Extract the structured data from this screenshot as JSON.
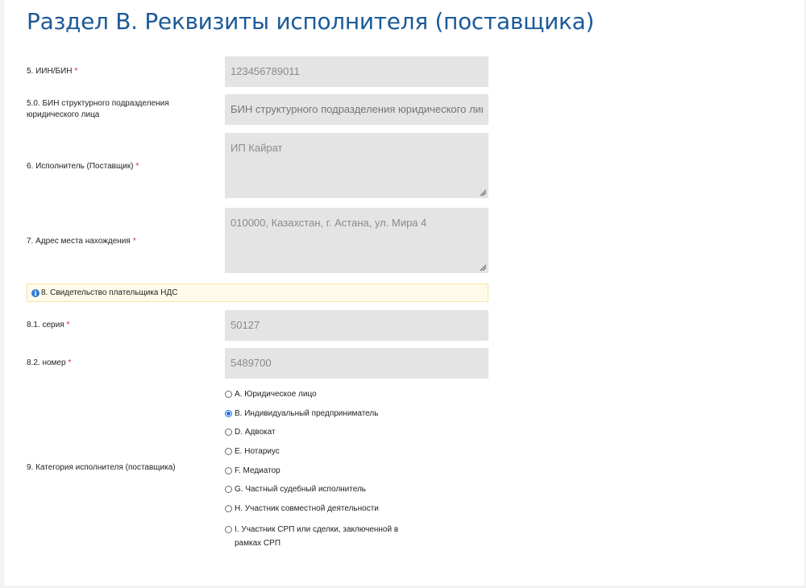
{
  "section": {
    "title": "Раздел B. Реквизиты исполнителя (поставщика)"
  },
  "fields": {
    "iin_bin": {
      "label": "5. ИИН/БИН",
      "value": "123456789011",
      "required": "*"
    },
    "branch_bin": {
      "label": "5.0. БИН структурного подразделения юридического лица",
      "placeholder": "БИН структурного подразделения юридического лица"
    },
    "supplier": {
      "label": "6. Исполнитель (Поставщик)",
      "value": "ИП Кайрат",
      "required": "*"
    },
    "address": {
      "label": "7. Адрес места нахождения",
      "value": "010000, Казахстан, г. Астана, ул. Мира 4",
      "required": "*"
    },
    "vat_notice": {
      "icon": "info-icon",
      "label": "8. Свидетельство плательщика НДС"
    },
    "series": {
      "label": "8.1. серия",
      "value": "50127",
      "required": "*"
    },
    "number": {
      "label": "8.2. номер",
      "value": "5489700",
      "required": "*"
    },
    "category": {
      "label": "9. Категория исполнителя (поставщика)",
      "selected": "B",
      "options": [
        {
          "code": "A",
          "label": "A. Юридическое лицо"
        },
        {
          "code": "B",
          "label": "B. Индивидуальный предприниматель"
        },
        {
          "code": "D",
          "label": "D. Адвокат"
        },
        {
          "code": "E",
          "label": "E. Нотариус"
        },
        {
          "code": "F",
          "label": "F. Медиатор"
        },
        {
          "code": "G",
          "label": "G. Частный судебный исполнитель"
        },
        {
          "code": "H",
          "label": "H. Участник совместной деятельности"
        },
        {
          "code": "I",
          "label": "I. Участник СРП или сделки, заключенной в рамках СРП"
        }
      ]
    }
  },
  "colors": {
    "title": "#1b5a99",
    "required": "#e02020",
    "field_bg": "#e4e4e4",
    "notice_bg": "#fffbe8",
    "notice_border": "#f1e6a6",
    "radio_checked": "#1a73e8"
  }
}
